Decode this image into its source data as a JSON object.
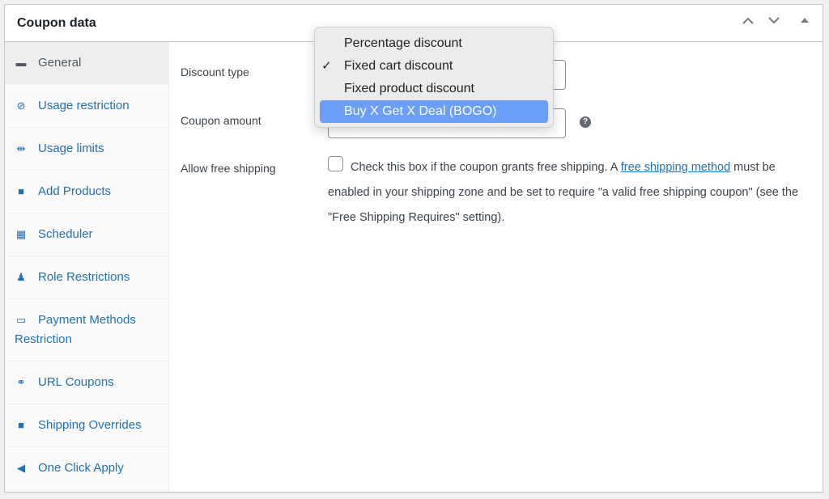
{
  "panel": {
    "title": "Coupon data",
    "controls": {
      "up": "⌃",
      "down": "⌄",
      "toggle": "▲"
    }
  },
  "sidebar": {
    "items": [
      {
        "label": "General",
        "icon": "ticket-icon",
        "glyph": "▬",
        "active": true
      },
      {
        "label": "Usage restriction",
        "icon": "block-icon",
        "glyph": "⊘"
      },
      {
        "label": "Usage limits",
        "icon": "limits-icon",
        "glyph": "⇹"
      },
      {
        "label": "Add Products",
        "icon": "bag-icon",
        "glyph": "■"
      },
      {
        "label": "Scheduler",
        "icon": "calendar-icon",
        "glyph": "▦"
      },
      {
        "label": "Role Restrictions",
        "icon": "user-icon",
        "glyph": "♟"
      },
      {
        "label": "Payment Methods Restriction",
        "icon": "card-icon",
        "glyph": "▭"
      },
      {
        "label": "URL Coupons",
        "icon": "link-icon",
        "glyph": "⚭"
      },
      {
        "label": "Shipping Overrides",
        "icon": "truck-icon",
        "glyph": "■"
      },
      {
        "label": "One Click Apply",
        "icon": "megaphone-icon",
        "glyph": "◀"
      }
    ]
  },
  "form": {
    "discount_type_label": "Discount type",
    "coupon_amount_label": "Coupon amount",
    "free_shipping_label": "Allow free shipping",
    "help_glyph": "?",
    "free_shipping_desc_1": "Check this box if the coupon grants free shipping. A ",
    "free_shipping_link": "free shipping method",
    "free_shipping_desc_2": " must be enabled in your shipping zone and be set to require \"a valid free shipping coupon\" (see the \"Free Shipping Requires\" setting)."
  },
  "dropdown": {
    "selected": "Fixed cart discount",
    "check_glyph": "✓",
    "options": [
      "Percentage discount",
      "Fixed cart discount",
      "Fixed product discount",
      "Buy X Get X Deal (BOGO)"
    ]
  }
}
